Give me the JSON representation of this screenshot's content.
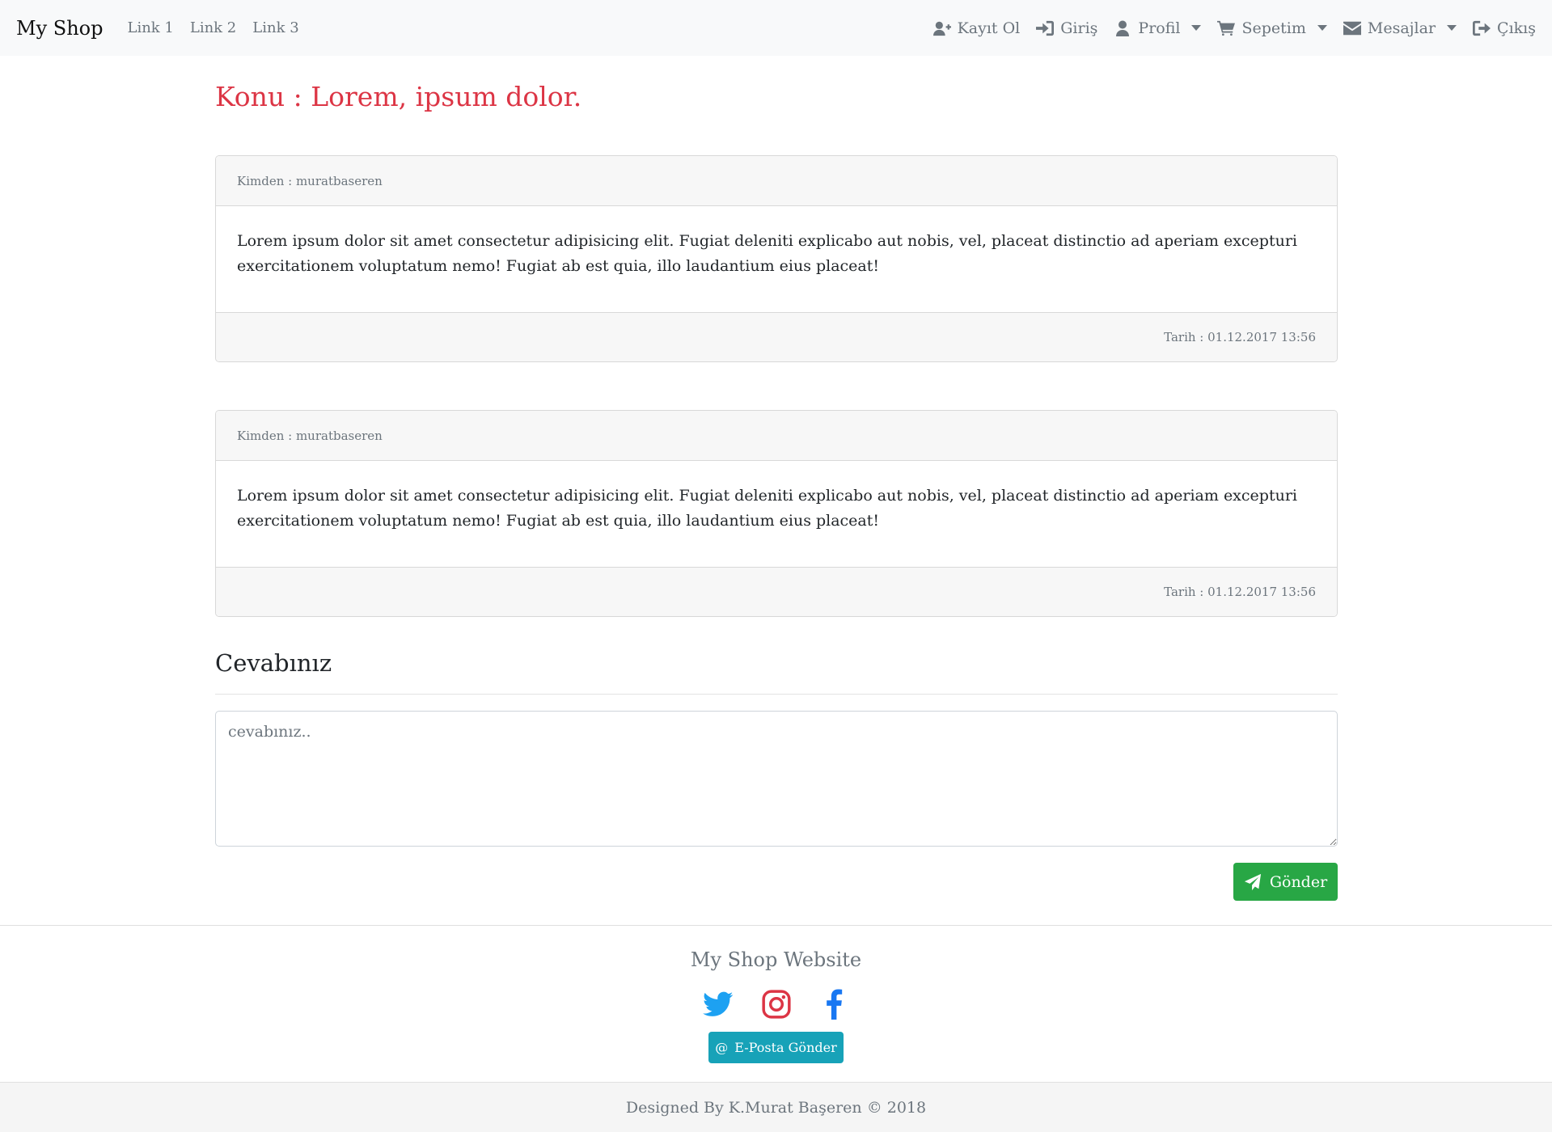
{
  "navbar": {
    "brand": "My Shop",
    "links": [
      "Link 1",
      "Link 2",
      "Link 3"
    ],
    "right": {
      "register": "Kayıt Ol",
      "login": "Giriş",
      "profile": "Profil",
      "cart": "Sepetim",
      "messages": "Mesajlar",
      "logout": "Çıkış"
    }
  },
  "subject": "Konu : Lorem, ipsum dolor.",
  "messages": [
    {
      "from": "Kimden : muratbaseren",
      "body": "Lorem ipsum dolor sit amet consectetur adipisicing elit. Fugiat deleniti explicabo aut nobis, vel, placeat distinctio ad aperiam excepturi exercitationem voluptatum nemo! Fugiat ab est quia, illo laudantium eius placeat!",
      "date": "Tarih : 01.12.2017 13:56"
    },
    {
      "from": "Kimden : muratbaseren",
      "body": "Lorem ipsum dolor sit amet consectetur adipisicing elit. Fugiat deleniti explicabo aut nobis, vel, placeat distinctio ad aperiam excepturi exercitationem voluptatum nemo! Fugiat ab est quia, illo laudantium eius placeat!",
      "date": "Tarih : 01.12.2017 13:56"
    }
  ],
  "reply": {
    "title": "Cevabınız",
    "placeholder": "cevabınız..",
    "send_label": "Gönder"
  },
  "footer": {
    "title": "My Shop Website",
    "social_icons": [
      "twitter-icon",
      "instagram-icon",
      "facebook-icon"
    ],
    "email_label": "E-Posta Gönder",
    "copyright": "Designed By K.Murat Başeren © 2018"
  },
  "colors": {
    "subject": "#dc3545",
    "send_button": "#28a745",
    "email_button": "#17a2b8",
    "twitter": "#1da1f2",
    "instagram": "#dc3545",
    "facebook": "#1877f2"
  }
}
